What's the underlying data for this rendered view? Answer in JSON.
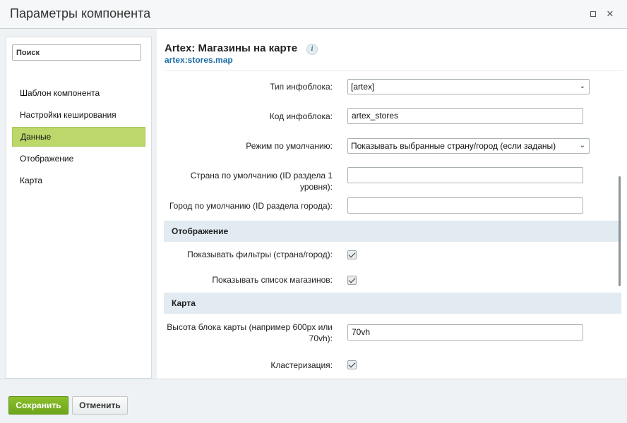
{
  "window": {
    "title": "Параметры компонента",
    "maximize_icon": "maximize-icon",
    "close_icon": "close-icon",
    "close_glyph": "✕"
  },
  "sidebar": {
    "search_placeholder": "Поиск",
    "items": [
      {
        "label": "Шаблон компонента"
      },
      {
        "label": "Настройки кеширования"
      },
      {
        "label": "Данные",
        "active": true
      },
      {
        "label": "Отображение"
      },
      {
        "label": "Карта"
      }
    ]
  },
  "component": {
    "title": "Artex: Магазины на карте",
    "code": "artex:stores.map",
    "info_glyph": "i"
  },
  "fields": {
    "iblock_type": {
      "label": "Тип инфоблока:",
      "value": "[artex]"
    },
    "iblock_code": {
      "label": "Код инфоблока:",
      "value": "artex_stores"
    },
    "default_mode": {
      "label": "Режим по умолчанию:",
      "value": "Показывать выбранные страну/город (если заданы)"
    },
    "default_country": {
      "label": "Страна по умолчанию (ID раздела 1 уровня):",
      "value": ""
    },
    "default_city": {
      "label": "Город по умолчанию (ID раздела города):",
      "value": ""
    },
    "show_filters": {
      "label": "Показывать фильтры (страна/город):",
      "checked": true
    },
    "show_store_list": {
      "label": "Показывать список магазинов:",
      "checked": true
    },
    "map_height": {
      "label_line1": "Высота блока карты (например 600px или",
      "label_line2": "70vh):",
      "value": "70vh"
    },
    "clustering": {
      "label": "Кластеризация:",
      "checked": true
    }
  },
  "sections": {
    "display": "Отображение",
    "map": "Карта"
  },
  "footer": {
    "save_label": "Сохранить",
    "cancel_label": "Отменить"
  },
  "colors": {
    "active_item": "#bcd86b",
    "section_bg": "#e1ebf1",
    "save_button": "#7ab022",
    "link": "#1b6ca8"
  }
}
